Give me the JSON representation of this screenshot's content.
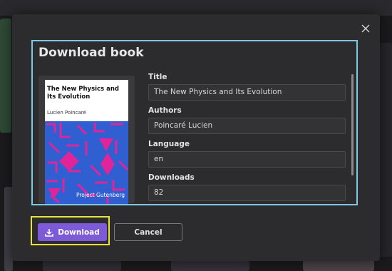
{
  "dialog": {
    "title": "Download book",
    "close_icon": "close-icon"
  },
  "cover": {
    "title": "The New Physics and Its Evolution",
    "author": "Lucien Poincaré",
    "publisher": "Project Gutenberg",
    "colors": {
      "background": "#2f5fd0",
      "pattern": "#e0259a"
    }
  },
  "fields": [
    {
      "label": "Title",
      "value": "The New Physics and Its Evolution"
    },
    {
      "label": "Authors",
      "value": "Poincaré Lucien"
    },
    {
      "label": "Language",
      "value": "en"
    },
    {
      "label": "Downloads",
      "value": "82"
    }
  ],
  "actions": {
    "download_label": "Download",
    "download_icon": "download-icon",
    "cancel_label": "Cancel"
  },
  "colors": {
    "accent": "#7c5ad8",
    "focus_outline": "#7ec8e3",
    "highlight_outline": "#e8e23a"
  }
}
